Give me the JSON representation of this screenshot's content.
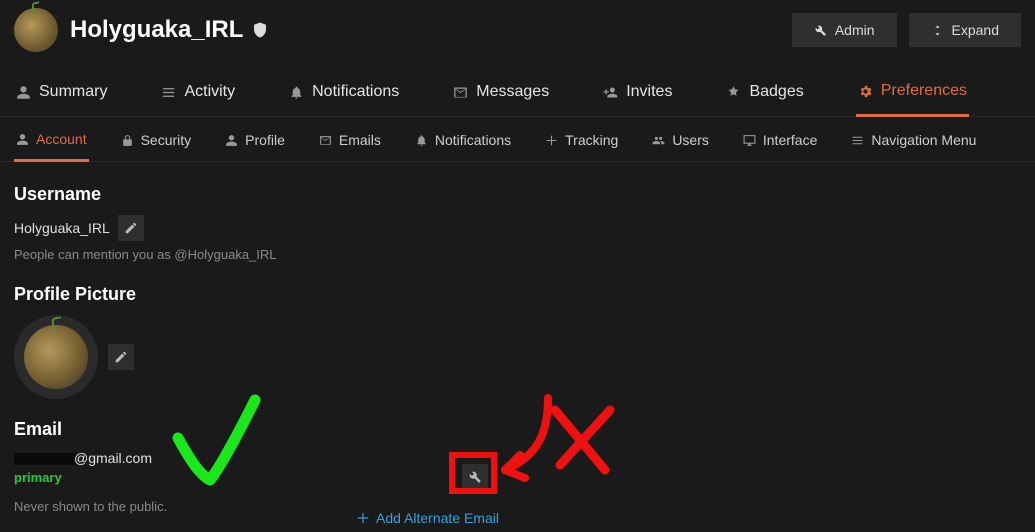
{
  "header": {
    "username": "Holyguaka_IRL",
    "admin_label": "Admin",
    "expand_label": "Expand"
  },
  "primaryTabs": [
    {
      "icon": "user-icon",
      "label": "Summary"
    },
    {
      "icon": "list-icon",
      "label": "Activity"
    },
    {
      "icon": "bell-icon",
      "label": "Notifications"
    },
    {
      "icon": "envelope-icon",
      "label": "Messages"
    },
    {
      "icon": "user-plus-icon",
      "label": "Invites"
    },
    {
      "icon": "badge-icon",
      "label": "Badges"
    },
    {
      "icon": "gear-icon",
      "label": "Preferences"
    }
  ],
  "primaryActive": 6,
  "secondaryTabs": [
    {
      "icon": "user-icon",
      "label": "Account"
    },
    {
      "icon": "lock-icon",
      "label": "Security"
    },
    {
      "icon": "user-icon",
      "label": "Profile"
    },
    {
      "icon": "envelope-icon",
      "label": "Emails"
    },
    {
      "icon": "bell-icon",
      "label": "Notifications"
    },
    {
      "icon": "plus-icon",
      "label": "Tracking"
    },
    {
      "icon": "users-icon",
      "label": "Users"
    },
    {
      "icon": "desktop-icon",
      "label": "Interface"
    },
    {
      "icon": "list-icon",
      "label": "Navigation Menu"
    }
  ],
  "secondaryActive": 0,
  "account": {
    "username_heading": "Username",
    "username_value": "Holyguaka_IRL",
    "mention_hint": "People can mention you as @Holyguaka_IRL",
    "picture_heading": "Profile Picture",
    "email_heading": "Email",
    "email_visible_part": "@gmail.com",
    "primary_label": "primary",
    "never_shown": "Never shown to the public.",
    "add_alternate": "Add Alternate Email"
  }
}
